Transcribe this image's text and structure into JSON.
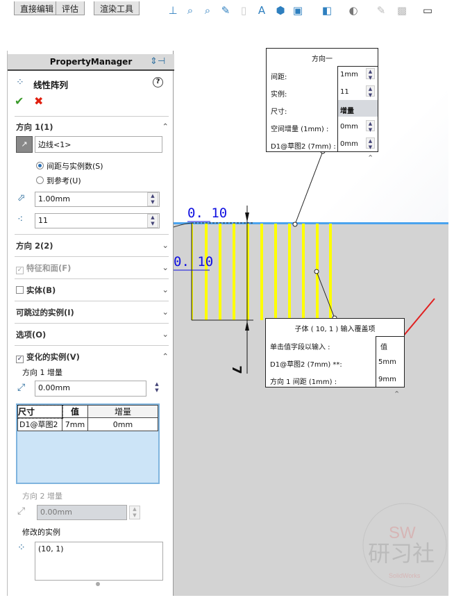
{
  "toolbar": {
    "tabs": [
      "直接编辑",
      "评估",
      "渲染工具"
    ],
    "icons": [
      "view-orientation-icon",
      "zoom-fit-icon",
      "zoom-area-icon",
      "previous-view-icon",
      "section-view-icon",
      "dynamic-annotation-icon",
      "display-style-icon",
      "hide-show-icon",
      "view-setting-icon",
      "appearance-icon",
      "scene-icon",
      "monitor-icon"
    ]
  },
  "panel": {
    "header": "PropertyManager",
    "feature_title": "线性阵列",
    "dir1": {
      "title": "方向 1(1)",
      "edge": "边线<1>",
      "radio1": "间距与实例数(S)",
      "radio2": "到参考(U)",
      "spacing": "1.00mm",
      "count": "11"
    },
    "sections": [
      "方向 2(2)",
      "特征和面(F)",
      "实体(B)",
      "可跳过的实例(I)",
      "选项(O)"
    ],
    "varied": {
      "title": "变化的实例(V)",
      "dir1_label": "方向 1 增量",
      "dir1_value": "0.00mm",
      "table": {
        "headers": [
          "尺寸",
          "值",
          "增量"
        ],
        "rows": [
          [
            "D1@草图2",
            "7mm",
            "0mm"
          ]
        ]
      },
      "dir2_label": "方向 2 增量",
      "dir2_value": "0.00mm",
      "modified_label": "修改的实例",
      "modified_value": "(10, 1)"
    }
  },
  "callout1": {
    "title": "方向一",
    "rows": [
      {
        "label": "间距:",
        "value": "1mm"
      },
      {
        "label": "实例:",
        "value": "11"
      },
      {
        "label": "尺寸:",
        "value": "增量"
      },
      {
        "label": "空间增量 (1mm) :",
        "value": "0mm"
      },
      {
        "label": "D1@草图2 (7mm) :",
        "value": "0mm"
      }
    ]
  },
  "callout2": {
    "title": "子体 ( 10,  1 ) 输入覆盖项",
    "rows": [
      {
        "label": "单击值字段以输入 :",
        "value": "值"
      },
      {
        "label": "D1@草图2 (7mm) **:",
        "value": "5mm"
      },
      {
        "label": "方向 1 间距 (1mm) :",
        "value": "9mm"
      }
    ]
  },
  "dims": {
    "d1": "0. 10",
    "d2": "0. 10",
    "d3": "7"
  },
  "watermark": {
    "line1": "SW",
    "line2": "研习社",
    "line3": "SolidWorks"
  },
  "colors": {
    "accent": "#2a6fb5",
    "pattern": "#ffff00",
    "arrow": "#e02020"
  }
}
